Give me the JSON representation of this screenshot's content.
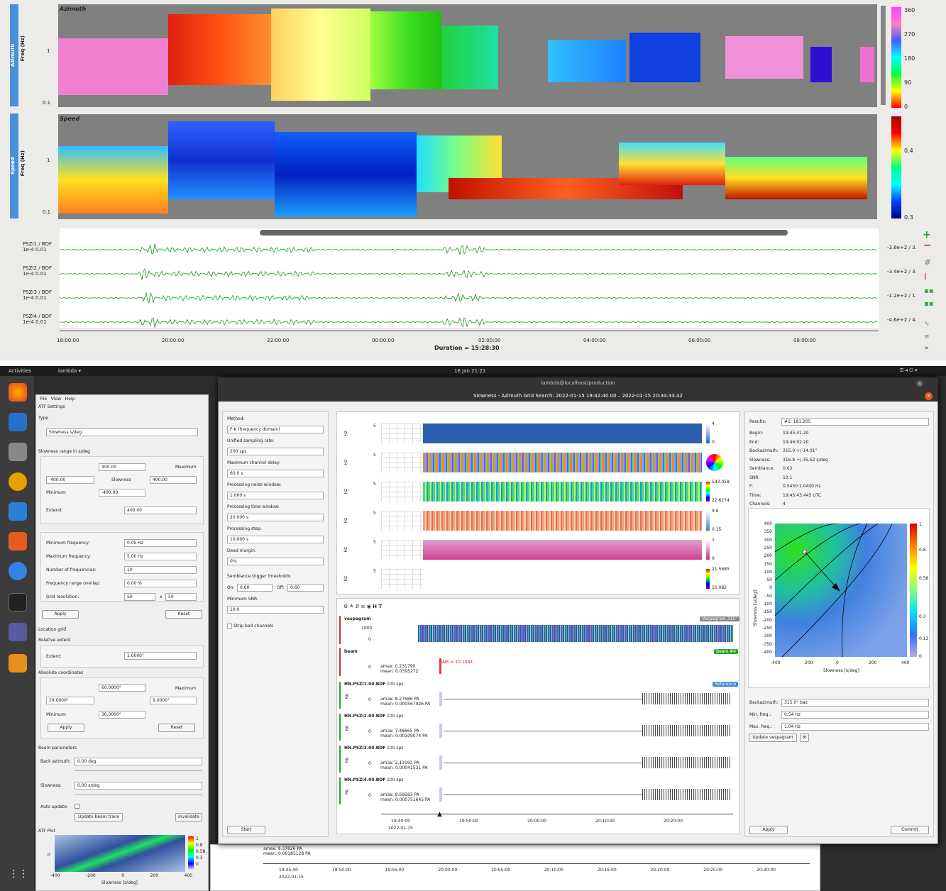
{
  "top": {
    "panel1": {
      "tab": "Azimuth",
      "ylabel": "Freq (Hz)",
      "title": "Azimuth",
      "y_ticks": [
        "1",
        "0.1"
      ],
      "cbar_ticks": [
        "360",
        "270",
        "180",
        "90",
        "0"
      ]
    },
    "panel2": {
      "tab": "Speed",
      "ylabel": "Freq (Hz)",
      "title": "Speed",
      "y_ticks": [
        "1",
        "0.1"
      ],
      "cbar_ticks": [
        "0.4",
        "0.3"
      ]
    },
    "traces": [
      {
        "name": "PSZI1 / BDF",
        "scale": "1e-4 0.01",
        "value": "-3.6e+2 / 3."
      },
      {
        "name": "PSZI2 / BDF",
        "scale": "1e-4 0.01",
        "value": "-3.4e+2 / 3."
      },
      {
        "name": "PSZI3 / BDF",
        "scale": "1e-4 0.01",
        "value": "-1.2e+2 / 1."
      },
      {
        "name": "PSZI4 / BDF",
        "scale": "1e-4 0.01",
        "value": "-4.6e+2 / 4."
      }
    ],
    "xticks": [
      "18:00:00",
      "20:00:00",
      "22:00:00",
      "00:00:00",
      "02:00:00",
      "04:00:00",
      "06:00:00",
      "08:00:00"
    ],
    "duration": "Duration = 15:28:30"
  },
  "desktop": {
    "activities": "Activities",
    "app": "lambda ▾",
    "clock": "16 Jan  21:21"
  },
  "left": {
    "menu": [
      "File",
      "View",
      "Help"
    ],
    "atf_settings": "ATF Settings",
    "type_label": "Type",
    "type_value": "Slowness s/deg",
    "slowness_range": "Slowness range in s/deg",
    "max_label": "Maximum",
    "min_label": "Minimum",
    "slowness_label": "Slowness",
    "extend_label": "Extend:",
    "v_400a": "400.00",
    "v_neg400": "-400.00",
    "v_400b": "400.00",
    "v_neg400b": "-400.00",
    "v_extend": "400.00",
    "min_freq_label": "Minimum frequency:",
    "min_freq": "0.05 Hz",
    "max_freq_label": "Maximum frequency:",
    "max_freq": "5.00 Hz",
    "nfreq_label": "Number of frequencies:",
    "nfreq": "10",
    "overlap_label": "Frequency range overlap:",
    "overlap": "0.00 %",
    "grid_label": "Grid resolution:",
    "grid_a": "50",
    "grid_x": "x",
    "grid_b": "50",
    "apply": "Apply",
    "reset": "Reset",
    "location_grid": "Location grid",
    "relative_extent": "Relative extent",
    "extent_label": "Extent:",
    "extent": "1.0000°",
    "absolute": "Absolute coordinates",
    "abs_max": "60.0000°",
    "abs_left": "29.0000°",
    "abs_right": "9.0000°",
    "abs_min": "30.0000°",
    "apply2": "Apply",
    "reset2": "Reset",
    "beam_params": "Beam parameters",
    "baz_label": "Back azimuth:",
    "baz": "0.00 deg",
    "slow_label": "Slowness:",
    "slow": "0.00 s/deg",
    "auto_update": "Auto update:",
    "update_beam": "Update beam trace",
    "invalidate": "Invalidate",
    "atf_plot": "ATF Plot",
    "atf_xlabel": "Slowness [s/deg]",
    "atf_xticks": [
      "-400",
      "-200",
      "0",
      "200",
      "400"
    ],
    "atf_ytick": "0",
    "atf_cbar": [
      "1",
      "0.8",
      "0.58",
      "0.3",
      "0.13",
      "0"
    ]
  },
  "main": {
    "window_title": "lambda@localhost/production",
    "dialog_title": "Slowness - Azimuth Grid Search: 2022-01-15 19:42:40.00 – 2022-01-15 20:34:33.42",
    "method_label": "Method:",
    "method": "F-K (frequency domain)",
    "usr_label": "Unified sampling rate:",
    "usr": "200 sps",
    "mcd_label": "Maximum channel delay:",
    "mcd": "60.0 s",
    "pnw_label": "Processing noise window:",
    "pnw": "1.000 s",
    "ptw_label": "Processing time window:",
    "ptw": "20.000 s",
    "ps_label": "Processing step:",
    "ps": "10.000 s",
    "dm_label": "Dead margin:",
    "dm": "0%",
    "stt_label": "Semblance trigger thresholds:",
    "on_label": "On:",
    "on": "0.60",
    "off_label": "Off:",
    "off": "0.60",
    "msnr_label": "Minimum SNR:",
    "msnr": "10.0",
    "strip": "Strip bad channels",
    "start": "Start",
    "hm_ylabel": "Hz",
    "hm_ytick": "5",
    "hm_cbars": [
      [
        "4",
        "0"
      ],
      [
        "",
        ""
      ],
      [
        "543.058",
        "22.6274"
      ],
      [
        "9.6",
        "0.15"
      ],
      [
        "1",
        "0"
      ],
      [
        "21.5685",
        "10.082"
      ]
    ],
    "vespagram": "vespagram",
    "vesp_badge": "Vespagram 315°",
    "vesp_ticks": [
      "1000",
      "0"
    ],
    "beam": "beam",
    "beam_badge": "Beam #4",
    "beam_amax": "amax: 0.231799",
    "beam_mean": "mean: 0.0395272",
    "snr": "SNR = 10.1384",
    "ref_badge": "Reference",
    "traces": [
      {
        "name": "HN.PSZI1.00.BDF",
        "sps": "100 sps",
        "amax": "amax: 8.27686 PA",
        "mean": "mean: 0.000567026 PA"
      },
      {
        "name": "HN.PSZI2.00.BDF",
        "sps": "100 sps",
        "amax": "amax: 7.46665 PA",
        "mean": "mean: 0.00109074 PA"
      },
      {
        "name": "HN.PSZI3.00.BDF",
        "sps": "100 sps",
        "amax": "amax: 2.13192 PA",
        "mean": "mean: 0.00041531 PA"
      },
      {
        "name": "HN.PSZI4.00.BDF",
        "sps": "100 sps",
        "amax": "amax: 8.69583 PA",
        "mean": "mean: 0.000751645 PA"
      }
    ],
    "trace_unit": "PA",
    "trace_zero": "0",
    "xticks": [
      "19:40:00",
      "19:50:00",
      "20:00:00",
      "20:10:00",
      "20:20:00"
    ],
    "xdate": "2022-01-15",
    "results_label": "Results:",
    "results": "#1: 181.205",
    "res": [
      [
        "Begin:",
        "19:45:41.20"
      ],
      [
        "End:",
        "19:46:02.20"
      ],
      [
        "Backazimuth:",
        "315.0 +/-14.01°"
      ],
      [
        "Slowness:",
        "316.8 +/-35.52 s/deg"
      ],
      [
        "Semblance:",
        "0.63"
      ],
      [
        "SNR:",
        "10.1"
      ],
      [
        "F:",
        "0.5450:1.0400 Hz"
      ],
      [
        "Time:",
        "19:45:43.445 UTC"
      ],
      [
        "Channels:",
        "4"
      ]
    ],
    "fk_ylabel": "Slowness [s/deg]",
    "fk_xlabel": "Slowness [s/deg]",
    "fk_yticks": [
      "400",
      "350",
      "300",
      "250",
      "200",
      "150",
      "100",
      "50",
      "0",
      "-50",
      "-100",
      "-150",
      "-200",
      "-250",
      "-300",
      "-350",
      "-400"
    ],
    "fk_xticks": [
      "-400",
      "-200",
      "0",
      "200",
      "400"
    ],
    "fk_cbar": [
      "1",
      "0.8",
      "0.58",
      "0.3",
      "0.13",
      "0"
    ],
    "baz2_label": "Backazimuth:",
    "baz2": "315.0° baz",
    "minf_label": "Min. freq.:",
    "minf": "0.54 Hz",
    "maxf_label": "Max. freq.:",
    "maxf": "1.04 Hz",
    "update_vesp": "Update vespagram",
    "apply": "Apply",
    "commit": "Commit"
  },
  "behind": {
    "amax": "amax: 9.37826 PA",
    "mean": "mean: 0.00185128 PA",
    "xticks": [
      "19:45:00",
      "19:50:00",
      "19:55:00",
      "20:00:00",
      "20:05:00",
      "20:10:00",
      "20:15:00",
      "20:20:00",
      "20:25:00",
      "20:30:00"
    ],
    "xdate": "2022-01-15"
  }
}
